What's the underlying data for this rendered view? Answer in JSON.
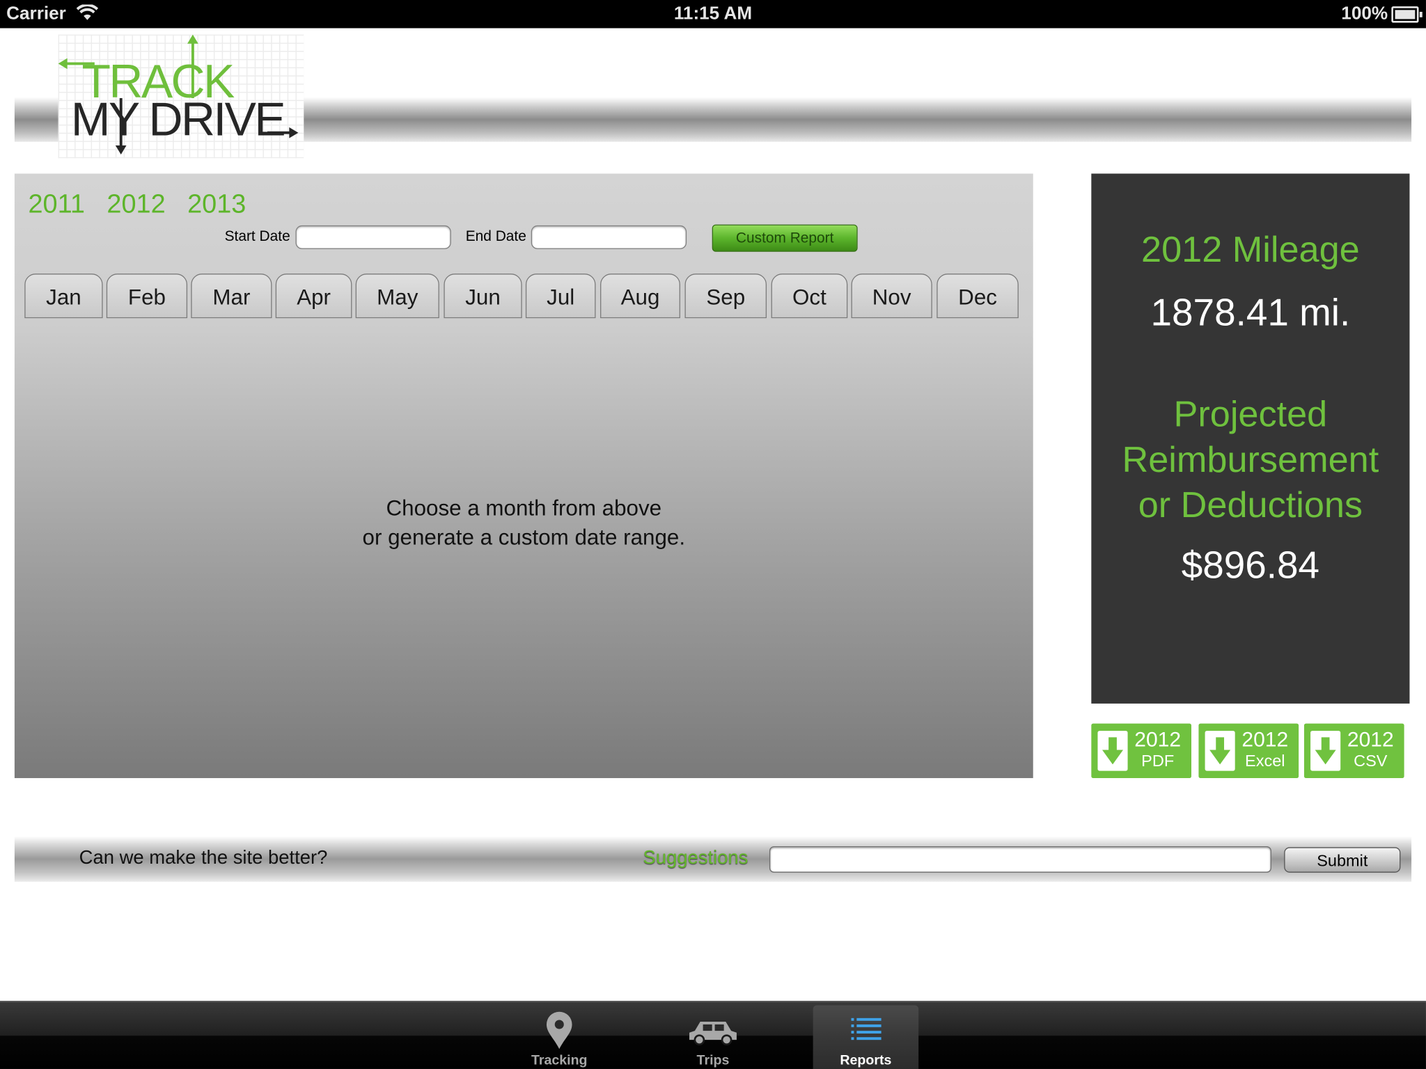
{
  "status_bar": {
    "carrier": "Carrier",
    "time": "11:15 AM",
    "battery": "100%"
  },
  "logo": {
    "line1": "TRACK",
    "line2": "MY DRIVE",
    "colors": {
      "green": "#6fbf3c",
      "dark": "#262626"
    }
  },
  "reports": {
    "years": [
      "2011",
      "2012",
      "2013"
    ],
    "start_date_label": "Start Date",
    "start_date_value": "",
    "end_date_label": "End Date",
    "end_date_value": "",
    "custom_report_button": "Custom Report",
    "months": [
      "Jan",
      "Feb",
      "Mar",
      "Apr",
      "May",
      "Jun",
      "Jul",
      "Aug",
      "Sep",
      "Oct",
      "Nov",
      "Dec"
    ],
    "hint_line1": "Choose a month from above",
    "hint_line2": "or generate a custom date range."
  },
  "summary": {
    "mileage_title": "2012 Mileage",
    "mileage_value": "1878.41 mi.",
    "reimbursement_line1": "Projected",
    "reimbursement_line2": "Reimbursement",
    "reimbursement_line3": "or Deductions",
    "reimbursement_value": "$896.84",
    "accent_color": "#6fc13e",
    "background_color": "#353535"
  },
  "downloads": [
    {
      "year": "2012",
      "format": "PDF",
      "icon": "download-arrow-icon"
    },
    {
      "year": "2012",
      "format": "Excel",
      "icon": "download-arrow-icon"
    },
    {
      "year": "2012",
      "format": "CSV",
      "icon": "download-arrow-icon"
    }
  ],
  "feedback": {
    "question": "Can we make the site better?",
    "suggestions_label": "Suggestions",
    "suggestions_value": "",
    "submit_button": "Submit"
  },
  "tab_bar": {
    "tabs": [
      {
        "label": "Tracking",
        "icon": "map-pin-icon",
        "active": false
      },
      {
        "label": "Trips",
        "icon": "car-icon",
        "active": false
      },
      {
        "label": "Reports",
        "icon": "list-icon",
        "active": true
      }
    ]
  }
}
